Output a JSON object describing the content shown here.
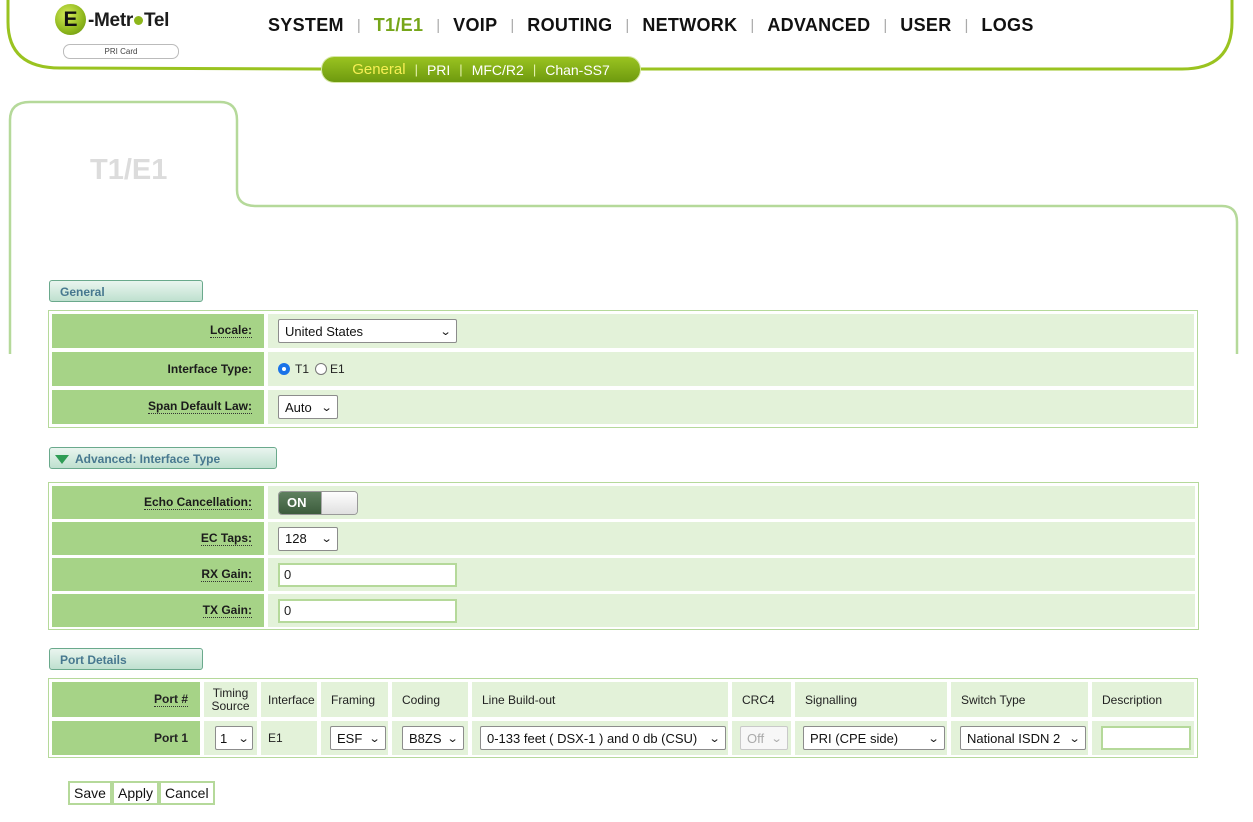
{
  "logo": {
    "letter": "E",
    "name_part1": "-Metr",
    "name_part2": "Tel",
    "badge": "PRI Card"
  },
  "main_nav": [
    {
      "label": "SYSTEM"
    },
    {
      "label": "T1/E1",
      "active": true
    },
    {
      "label": "VOIP"
    },
    {
      "label": "ROUTING"
    },
    {
      "label": "NETWORK"
    },
    {
      "label": "ADVANCED"
    },
    {
      "label": "USER"
    },
    {
      "label": "LOGS"
    }
  ],
  "sub_nav": [
    {
      "label": "General",
      "active": true
    },
    {
      "label": "PRI"
    },
    {
      "label": "MFC/R2"
    },
    {
      "label": "Chan-SS7"
    }
  ],
  "page_title": "T1/E1",
  "general": {
    "section_label": "General",
    "locale": {
      "label": "Locale:",
      "value": "United States"
    },
    "interface_type": {
      "label": "Interface Type:",
      "options": [
        "T1",
        "E1"
      ],
      "selected": "T1"
    },
    "span_default_law": {
      "label": "Span Default Law:",
      "value": "Auto"
    }
  },
  "advanced": {
    "section_label": "Advanced: Interface Type",
    "echo_cancellation": {
      "label": "Echo Cancellation:",
      "state": "ON"
    },
    "ec_taps": {
      "label": "EC Taps:",
      "value": "128"
    },
    "rx_gain": {
      "label": "RX Gain:",
      "value": "0"
    },
    "tx_gain": {
      "label": "TX Gain:",
      "value": "0"
    }
  },
  "port_details": {
    "section_label": "Port Details",
    "headers": {
      "port": "Port #",
      "timing1": "Timing",
      "timing2": "Source",
      "interface": "Interface",
      "framing": "Framing",
      "coding": "Coding",
      "lbo": "Line Build-out",
      "crc4": "CRC4",
      "signalling": "Signalling",
      "switch_type": "Switch Type",
      "description": "Description"
    },
    "row": {
      "port": "Port 1",
      "timing_source": "1",
      "interface": "E1",
      "framing": "ESF",
      "coding": "B8ZS",
      "lbo": "0-133 feet ( DSX-1 ) and 0 db (CSU)",
      "crc4": "Off",
      "signalling": "PRI (CPE side)",
      "switch_type": "National ISDN 2",
      "description": ""
    }
  },
  "buttons": {
    "save": "Save",
    "apply": "Apply",
    "cancel": "Cancel"
  },
  "colors": {
    "accent": "#8db61b",
    "label_bg": "#a6d387",
    "value_bg": "#e3f2d9",
    "tab_text": "#47788f"
  }
}
